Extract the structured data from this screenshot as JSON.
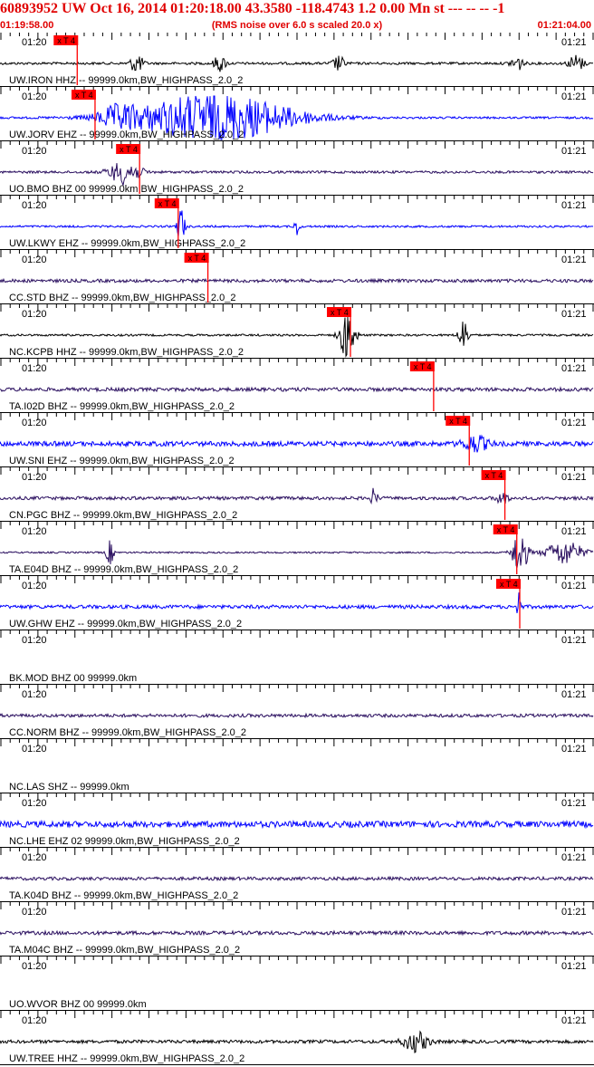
{
  "header": {
    "title": "60893952 UW Oct 16, 2014 01:20:18.00   43.3580  -118.4743   1.2  0.00  Mn st  --- --  --   -1",
    "start_time": "01:19:58.00",
    "noise_note": "(RMS noise over 6.0 s scaled 20.0 x)",
    "end_time": "01:21:04.00"
  },
  "colors": {
    "title_red": "#e00000",
    "pick_red": "#ff0000",
    "black": "#000000",
    "blue": "#0000ff",
    "indigo": "#2b1060"
  },
  "time_labels": {
    "left": "01:20",
    "right": "01:21"
  },
  "pick_label": "x T 4",
  "traces": [
    {
      "label": "UW.IRON HHZ -- 99999.0km,BW_HIGHPASS_2.0_2",
      "color": "black",
      "amp": 0.3,
      "pick": 0.13,
      "bursts": [
        {
          "at": 0.23,
          "amp": 2.5,
          "w": 0.01
        },
        {
          "at": 0.37,
          "amp": 2.0,
          "w": 0.01
        },
        {
          "at": 0.57,
          "amp": 1.8,
          "w": 0.01
        },
        {
          "at": 0.87,
          "amp": 2.0,
          "w": 0.01
        },
        {
          "at": 0.97,
          "amp": 2.2,
          "w": 0.012
        }
      ]
    },
    {
      "label": "UW.JORV EHZ -- 99999.0km,BW_HIGHPASS_2.0_2",
      "color": "blue",
      "amp": 0.25,
      "pick": 0.16,
      "bursts": [
        {
          "at": 0.36,
          "amp": 6.0,
          "w": 0.13
        },
        {
          "at": 0.2,
          "amp": 2.2,
          "w": 0.03
        }
      ]
    },
    {
      "label": "UO.BMO BHZ 00 99999.0km,BW_HIGHPASS_2.0_2",
      "color": "indigo",
      "amp": 0.3,
      "pick": 0.235,
      "bursts": [
        {
          "at": 0.21,
          "amp": 3.0,
          "w": 0.025
        }
      ]
    },
    {
      "label": "UW.LKWY EHZ -- 99999.0km,BW_HIGHPASS_2.0_2",
      "color": "blue",
      "amp": 0.25,
      "pick": 0.3,
      "bursts": [
        {
          "at": 0.305,
          "amp": 5.0,
          "w": 0.006
        },
        {
          "at": 0.5,
          "amp": 2.5,
          "w": 0.004
        }
      ]
    },
    {
      "label": "CC.STD BHZ -- 99999.0km,BW_HIGHPASS_2.0_2",
      "color": "indigo",
      "amp": 0.4,
      "pick": 0.35,
      "bursts": []
    },
    {
      "label": "NC.KCPB HHZ -- 99999.0km,BW_HIGHPASS_2.0_2",
      "color": "black",
      "amp": 0.25,
      "pick": 0.59,
      "bursts": [
        {
          "at": 0.585,
          "amp": 6.5,
          "w": 0.012
        },
        {
          "at": 0.78,
          "amp": 4.0,
          "w": 0.008
        }
      ]
    },
    {
      "label": "TA.I02D BHZ -- 99999.0km,BW_HIGHPASS_2.0_2",
      "color": "indigo",
      "amp": 0.45,
      "pick": 0.73,
      "bursts": []
    },
    {
      "label": "UW.SNI EHZ -- 99999.0km,BW_HIGHPASS_2.0_2",
      "color": "blue",
      "amp": 0.6,
      "pick": 0.79,
      "bursts": [
        {
          "at": 0.8,
          "amp": 2.0,
          "w": 0.02
        }
      ]
    },
    {
      "label": "CN.PGC BHZ -- 99999.0km,BW_HIGHPASS_2.0_2",
      "color": "indigo",
      "amp": 0.4,
      "pick": 0.85,
      "bursts": [
        {
          "at": 0.63,
          "amp": 2.5,
          "w": 0.005
        },
        {
          "at": 0.845,
          "amp": 1.5,
          "w": 0.01
        }
      ]
    },
    {
      "label": "TA.E04D BHZ -- 99999.0km,BW_HIGHPASS_2.0_2",
      "color": "indigo",
      "amp": 0.2,
      "pick": 0.87,
      "bursts": [
        {
          "at": 0.185,
          "amp": 3.0,
          "w": 0.006
        },
        {
          "at": 0.875,
          "amp": 6.0,
          "w": 0.012
        },
        {
          "at": 0.95,
          "amp": 3.0,
          "w": 0.03
        }
      ]
    },
    {
      "label": "UW.GHW EHZ -- 99999.0km,BW_HIGHPASS_2.0_2",
      "color": "blue",
      "amp": 0.45,
      "pick": 0.875,
      "bursts": [
        {
          "at": 0.873,
          "amp": 5.0,
          "w": 0.003
        }
      ]
    },
    {
      "label": "BK.MOD BHZ 00 99999.0km",
      "color": "black",
      "amp": 0.0,
      "pick": null,
      "bursts": []
    },
    {
      "label": "CC.NORM BHZ -- 99999.0km,BW_HIGHPASS_2.0_2",
      "color": "indigo",
      "amp": 0.4,
      "pick": null,
      "bursts": []
    },
    {
      "label": "NC.LAS SHZ -- 99999.0km",
      "color": "black",
      "amp": 0.0,
      "pick": null,
      "bursts": []
    },
    {
      "label": "NC.LHE EHZ 02 99999.0km,BW_HIGHPASS_2.0_2",
      "color": "blue",
      "amp": 0.75,
      "pick": null,
      "bursts": []
    },
    {
      "label": "TA.K04D BHZ -- 99999.0km,BW_HIGHPASS_2.0_2",
      "color": "indigo",
      "amp": 0.4,
      "pick": null,
      "bursts": []
    },
    {
      "label": "TA.M04C BHZ -- 99999.0km,BW_HIGHPASS_2.0_2",
      "color": "indigo",
      "amp": 0.45,
      "pick": null,
      "bursts": []
    },
    {
      "label": "UO.WVOR BHZ 00 99999.0km",
      "color": "black",
      "amp": 0.0,
      "pick": null,
      "bursts": []
    },
    {
      "label": "UW.TREE HHZ -- 99999.0km,BW_HIGHPASS_2.0_2",
      "color": "black",
      "amp": 0.4,
      "pick": null,
      "bursts": [
        {
          "at": 0.7,
          "amp": 2.5,
          "w": 0.02
        }
      ]
    }
  ]
}
